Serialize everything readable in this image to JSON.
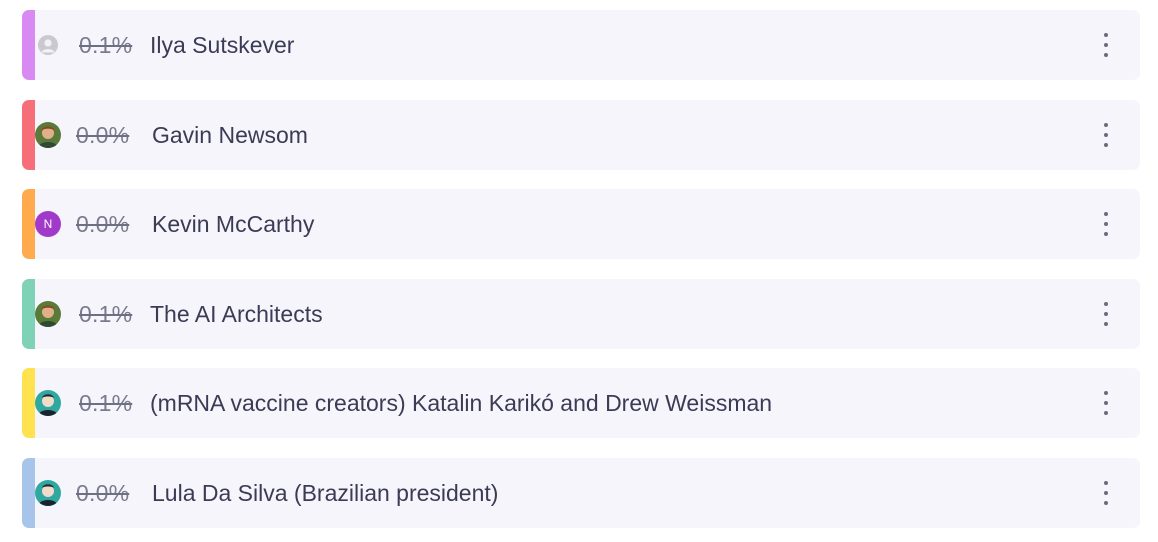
{
  "rows": [
    {
      "percent": "0.1%",
      "name": "Ilya Sutskever",
      "accent": "#d98af2",
      "avatar": "person-placeholder-icon"
    },
    {
      "percent": "0.0%",
      "name": "Gavin Newsom",
      "accent": "#f66f78",
      "avatar": "user-photo-avatar"
    },
    {
      "percent": "0.0%",
      "name": "Kevin McCarthy",
      "accent": "#ffaa4d",
      "avatar": "initial-avatar",
      "avatar_initial": "N"
    },
    {
      "percent": "0.1%",
      "name": "The AI Architects",
      "accent": "#7fd2b6",
      "avatar": "user-photo-avatar"
    },
    {
      "percent": "0.1%",
      "name": "(mRNA vaccine creators) Katalin Karikó and Drew Weissman",
      "accent": "#ffe24f",
      "avatar": "user-photo-avatar-teal"
    },
    {
      "percent": "0.0%",
      "name": "Lula Da Silva (Brazilian president)",
      "accent": "#a7c5ea",
      "avatar": "user-photo-avatar-teal"
    }
  ],
  "menu_icon": "more-vertical-icon"
}
